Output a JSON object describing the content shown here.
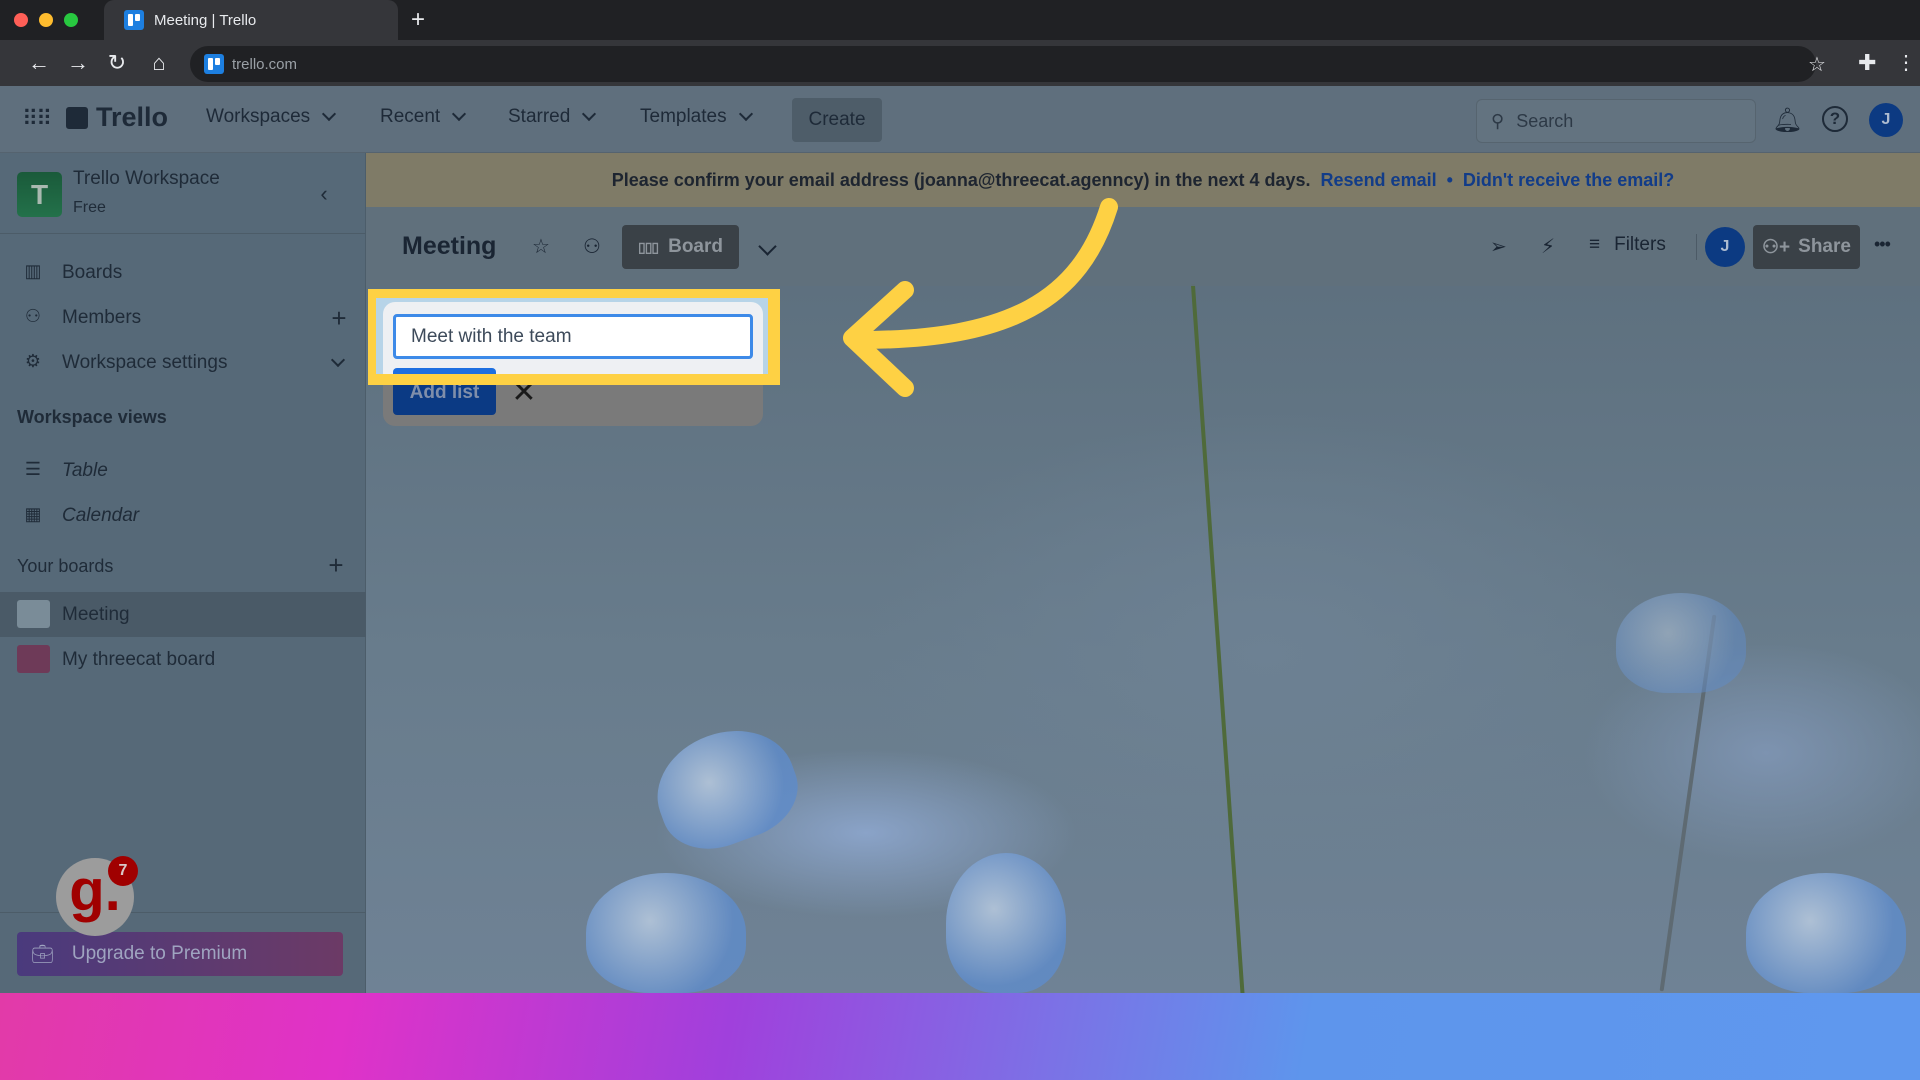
{
  "browser": {
    "tab_title": "Meeting | Trello",
    "new_tab_symbol": "+",
    "url": "trello.com",
    "window_controls": {
      "close_color": "#ff5f57",
      "minimize_color": "#febc2e",
      "maximize_color": "#28c840"
    }
  },
  "header": {
    "logo_text": "Trello",
    "nav": [
      {
        "label": "Workspaces"
      },
      {
        "label": "Recent"
      },
      {
        "label": "Starred"
      },
      {
        "label": "Templates"
      }
    ],
    "create_label": "Create",
    "search_placeholder": "Search",
    "avatar_initial": "J"
  },
  "sidebar": {
    "workspace_initial": "T",
    "workspace_name": "Trello Workspace",
    "workspace_plan": "Free",
    "items": [
      {
        "label": "Boards",
        "icon": "board-icon"
      },
      {
        "label": "Members",
        "icon": "person-icon"
      },
      {
        "label": "Workspace settings",
        "icon": "gear-icon"
      }
    ],
    "views_heading": "Workspace views",
    "views": [
      {
        "label": "Table",
        "icon": "table-icon"
      },
      {
        "label": "Calendar",
        "icon": "calendar-icon"
      }
    ],
    "boards_heading": "Your boards",
    "boards": [
      {
        "label": "Meeting",
        "color": "#7a8c98",
        "active": true
      },
      {
        "label": "My threecat board",
        "color": "#6e3a58",
        "active": false
      }
    ],
    "upgrade_label": "Upgrade to Premium",
    "guidde_badge_letter": "g.",
    "guidde_badge_count": "7"
  },
  "banner": {
    "message": "Please confirm your email address (joanna@threecat.agenncy) in the next 4 days.",
    "resend_link": "Resend email",
    "separator": "•",
    "help_link": "Didn't receive the email?"
  },
  "board": {
    "title": "Meeting",
    "view_label": "Board",
    "filters_label": "Filters",
    "member_initial": "J",
    "share_label": "Share",
    "more_symbol": "•••"
  },
  "add_list": {
    "input_value": "Meet with the team",
    "add_button_label": "Add list",
    "cancel_symbol": "✕"
  },
  "annotation": {
    "highlight_color": "#fed144"
  }
}
